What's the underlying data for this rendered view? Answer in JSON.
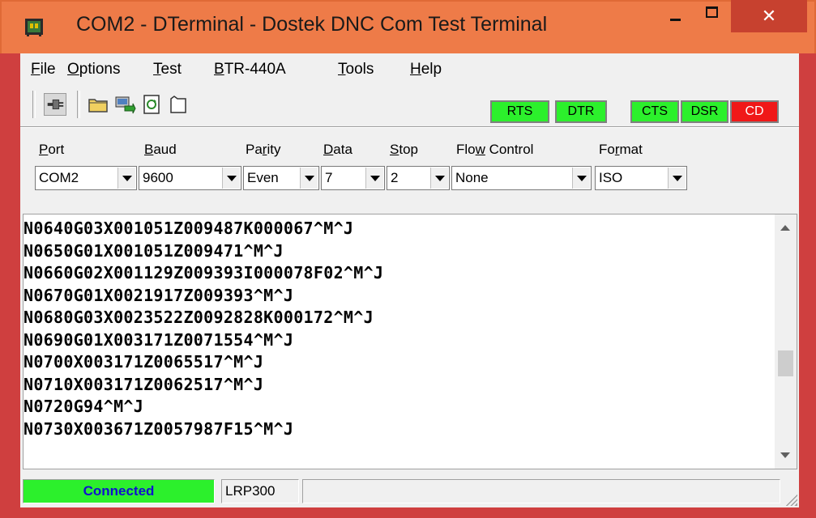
{
  "window": {
    "title": "COM2 - DTerminal - Dostek DNC Com Test Terminal",
    "close_label": "✕"
  },
  "menu": [
    {
      "prefix": "",
      "accel": "F",
      "rest": "ile"
    },
    {
      "prefix": "",
      "accel": "O",
      "rest": "ptions"
    },
    {
      "prefix": "",
      "accel": "T",
      "rest": "est"
    },
    {
      "prefix": "",
      "accel": "B",
      "rest": "TR-440A"
    },
    {
      "prefix": "",
      "accel": "T",
      "rest": "ools"
    },
    {
      "prefix": "",
      "accel": "H",
      "rest": "elp"
    }
  ],
  "toolbar": {
    "icons": [
      "connect-icon",
      "open-folder-icon",
      "send-file-icon",
      "refresh-icon",
      "new-document-icon"
    ]
  },
  "signals": [
    {
      "label": "RTS",
      "state": "on",
      "color": "#2cf02c"
    },
    {
      "label": "DTR",
      "state": "on",
      "color": "#2cf02c"
    },
    {
      "label": "CTS",
      "state": "on",
      "color": "#2cf02c"
    },
    {
      "label": "DSR",
      "state": "on",
      "color": "#2cf02c"
    },
    {
      "label": "CD",
      "state": "off",
      "color": "#f01818"
    }
  ],
  "settings": {
    "port": {
      "accel": "P",
      "rest": "ort",
      "value": "COM2"
    },
    "baud": {
      "accel": "B",
      "rest": "aud",
      "value": "9600"
    },
    "parity": {
      "pre": "Pa",
      "accel": "r",
      "rest": "ity",
      "value": "Even"
    },
    "data": {
      "accel": "D",
      "rest": "ata",
      "value": "7"
    },
    "stop": {
      "accel": "S",
      "rest": "top",
      "value": "2"
    },
    "flow": {
      "pre": "Flo",
      "accel": "w",
      "rest": " Control",
      "value": "None"
    },
    "format": {
      "pre": "Fo",
      "accel": "r",
      "rest": "mat",
      "value": "ISO"
    }
  },
  "terminal": {
    "lines": [
      "N0640G03X001051Z009487K000067^M^J",
      "N0650G01X001051Z009471^M^J",
      "N0660G02X001129Z009393I000078F02^M^J",
      "N0670G01X0021917Z009393^M^J",
      "N0680G03X0023522Z0092828K000172^M^J",
      "N0690G01X003171Z0071554^M^J",
      "N0700X003171Z0065517^M^J",
      "N0710X003171Z0062517^M^J",
      "N0720G94^M^J",
      "N0730X003671Z0057987F15^M^J"
    ]
  },
  "status": {
    "connection": "Connected",
    "device": "LRP300",
    "extra": ""
  }
}
